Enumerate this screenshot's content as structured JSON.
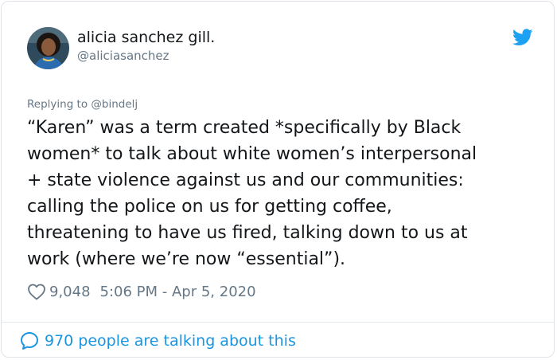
{
  "author": {
    "display_name": "alicia sanchez gill.",
    "handle": "@aliciasanchez"
  },
  "reply": {
    "prefix": "Replying to ",
    "mention": "@bindelj"
  },
  "tweet": {
    "text": "“Karen” was a term created *specifically by Black\nwomen* to talk about white women’s interpersonal\n+ state violence against us and our communities:\ncalling the police on us for getting coffee,\nthreatening to have us fired, talking down to us at\nwork (where we’re now “essential”)."
  },
  "meta": {
    "likes": "9,048",
    "timestamp": "5:06 PM - Apr 5, 2020"
  },
  "footer": {
    "talking": "970 people are talking about this"
  },
  "icons": {
    "brand": "twitter-bird-icon",
    "like": "heart-icon",
    "conversation": "speech-bubble-icon"
  },
  "colors": {
    "brand_blue": "#1da1f2",
    "link_blue": "#1b95e0",
    "text": "#14171a",
    "muted": "#657786"
  }
}
